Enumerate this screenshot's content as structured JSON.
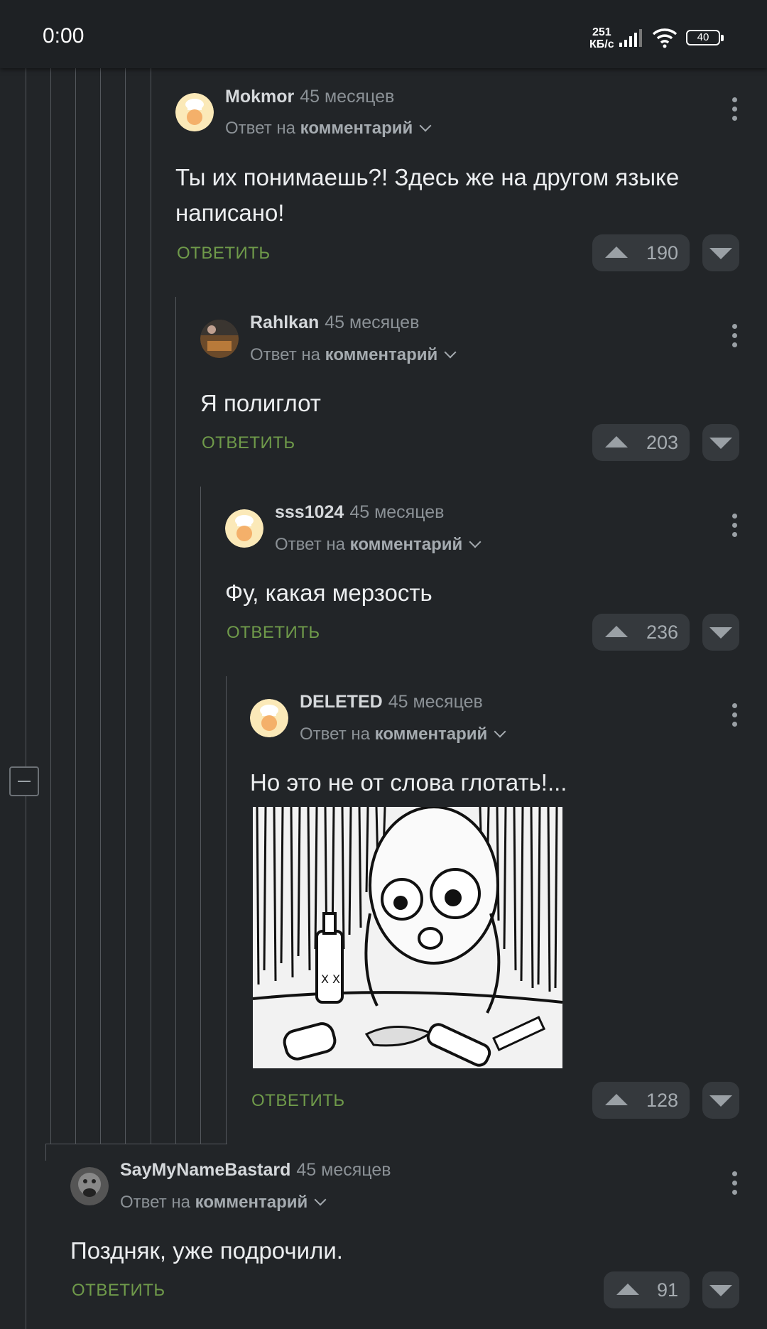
{
  "status_bar": {
    "time": "0:00",
    "net_speed_value": "251",
    "net_speed_unit": "КБ/с",
    "battery": "40"
  },
  "comments": [
    {
      "author": "Mokmor",
      "time_ago": "45 месяцев",
      "reply_prefix": "Ответ на",
      "reply_target": "комментарий",
      "text": "Ты их понимаешь?! Здесь же на другом языке написано!",
      "reply_label": "ОТВЕТИТЬ",
      "votes": "190"
    },
    {
      "author": "Rahlkan",
      "time_ago": "45 месяцев",
      "reply_prefix": "Ответ на",
      "reply_target": "комментарий",
      "text": "Я полиглот",
      "reply_label": "ОТВЕТИТЬ",
      "votes": "203"
    },
    {
      "author": "sss1024",
      "time_ago": "45 месяцев",
      "reply_prefix": "Ответ на",
      "reply_target": "комментарий",
      "text": "Фу, какая мерзость",
      "reply_label": "ОТВЕТИТЬ",
      "votes": "236"
    },
    {
      "author": "DELETED",
      "time_ago": "45 месяцев",
      "reply_prefix": "Ответ на",
      "reply_target": "комментарий",
      "text": "Но это не от слова глотать!...",
      "reply_label": "ОТВЕТИТЬ",
      "votes": "128"
    },
    {
      "author": "SayMyNameBastard",
      "time_ago": "45 месяцев",
      "reply_prefix": "Ответ на",
      "reply_target": "комментарий",
      "text": "Поздняк, уже подрочили.",
      "reply_label": "ОТВЕТИТЬ",
      "votes": "91"
    }
  ],
  "meme_bottle_label": "X X",
  "colors": {
    "background": "#222528",
    "reply_green": "#6f9a4a",
    "thread_line": "#54585d"
  }
}
